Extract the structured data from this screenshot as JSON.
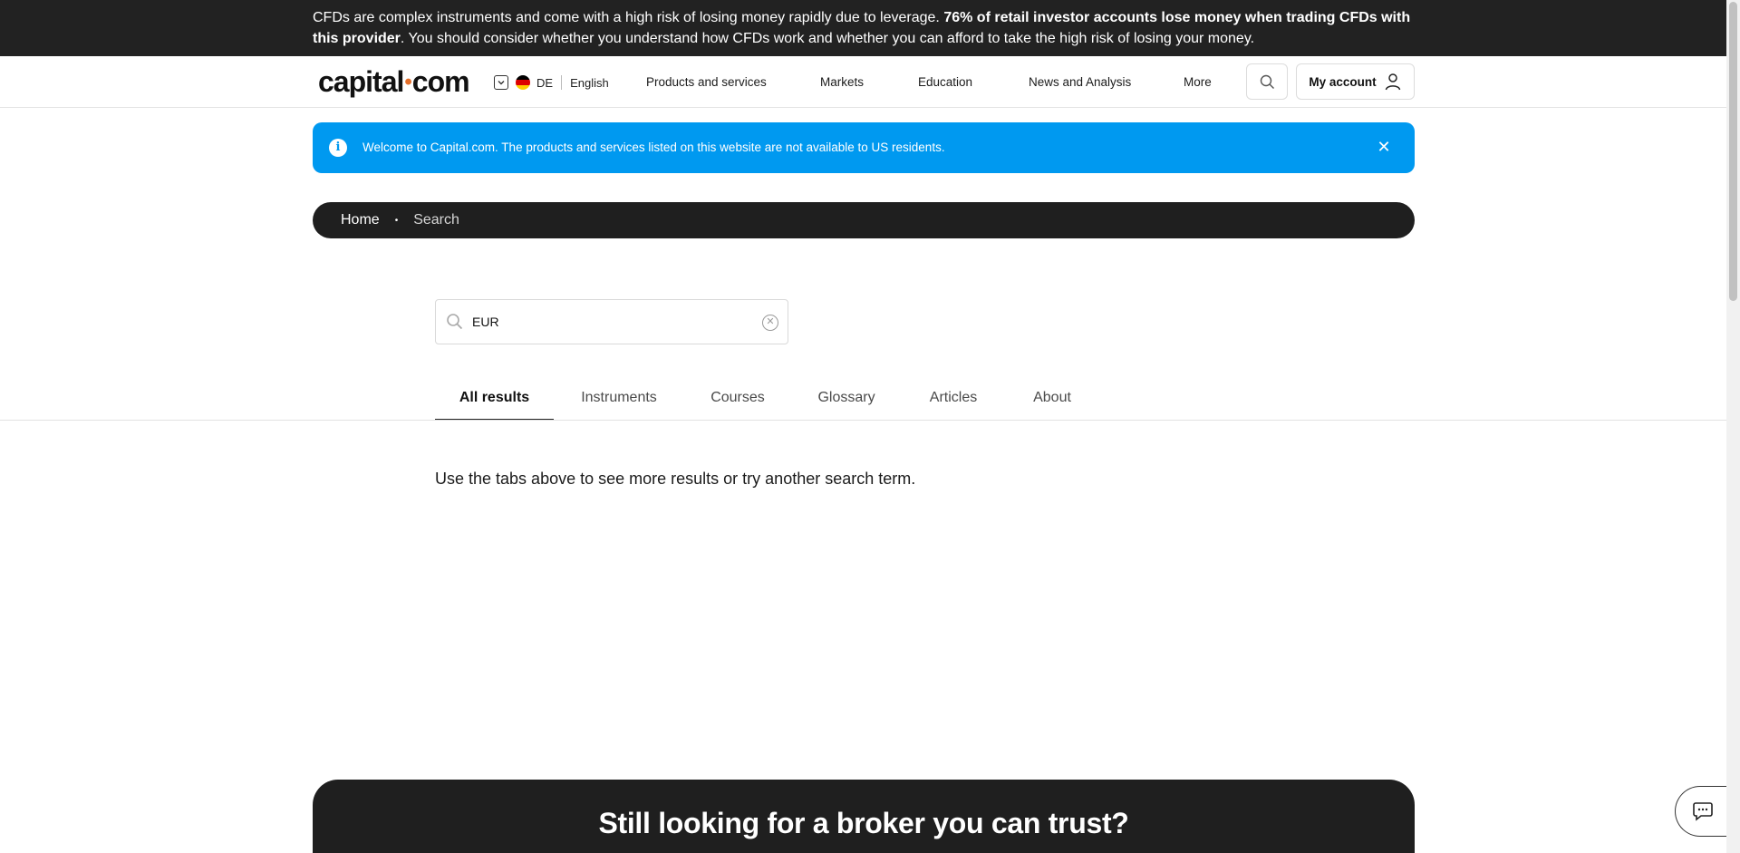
{
  "risk_warning": {
    "text_before": "CFDs are complex instruments and come with a high risk of losing money rapidly due to leverage. ",
    "text_bold": "76% of retail investor accounts lose money when trading CFDs with this provider",
    "text_after": ". You should consider whether you understand how CFDs work and whether you can afford to take the high risk of losing your money."
  },
  "header": {
    "logo_left": "capital",
    "logo_dot": "•",
    "logo_right": "com",
    "region_code": "DE",
    "language": "English",
    "nav": [
      "Products and services",
      "Markets",
      "Education",
      "News and Analysis",
      "More"
    ],
    "account_label": "My account",
    "flag_colors": [
      "#000000",
      "#dd0000",
      "#ffce00"
    ]
  },
  "info_banner": {
    "icon": "info-icon",
    "text": "Welcome to Capital.com. The products and services listed on this website are not available to US residents.",
    "close_glyph": "✕"
  },
  "breadcrumb": {
    "home": "Home",
    "separator": "•",
    "current": "Search"
  },
  "search": {
    "value": "EUR",
    "clear_glyph": "✕"
  },
  "tabs": [
    "All results",
    "Instruments",
    "Courses",
    "Glossary",
    "Articles",
    "About"
  ],
  "active_tab": "All results",
  "result_message": "Use the tabs above to see more results or try another search term.",
  "cta": {
    "title": "Still looking for a broker you can trust?"
  },
  "colors": {
    "banner_blue": "#0099f0",
    "dark": "#1f1f1f",
    "brand_dot": "#e46f2a"
  }
}
